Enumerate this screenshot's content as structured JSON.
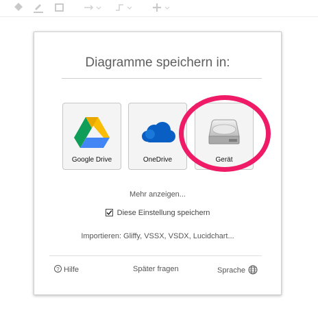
{
  "toolbar": {
    "icons": [
      "fill-bucket-icon",
      "pencil-line-icon",
      "shadow-square-icon",
      "arrow-right-dropdown-icon",
      "waypoint-dropdown-icon",
      "plus-dropdown-icon"
    ]
  },
  "dialog": {
    "title": "Diagramme speichern in:",
    "storage_options": [
      {
        "label": "Google Drive",
        "icon": "google-drive-icon"
      },
      {
        "label": "OneDrive",
        "icon": "onedrive-icon"
      },
      {
        "label": "Gerät",
        "icon": "hard-drive-icon",
        "highlighted": true
      }
    ],
    "more_link": "Mehr anzeigen...",
    "remember_setting": {
      "label": "Diese Einstellung speichern",
      "checked": true
    },
    "import_link": "Importieren: Gliffy, VSSX, VSDX, Lucidchart...",
    "footer": {
      "help_label": "Hilfe",
      "later_label": "Später fragen",
      "language_label": "Sprache"
    }
  },
  "colors": {
    "highlight_ring": "#ef1b66",
    "title_text": "#5e5e5e",
    "onedrive_blue": "#0a5fc4"
  }
}
